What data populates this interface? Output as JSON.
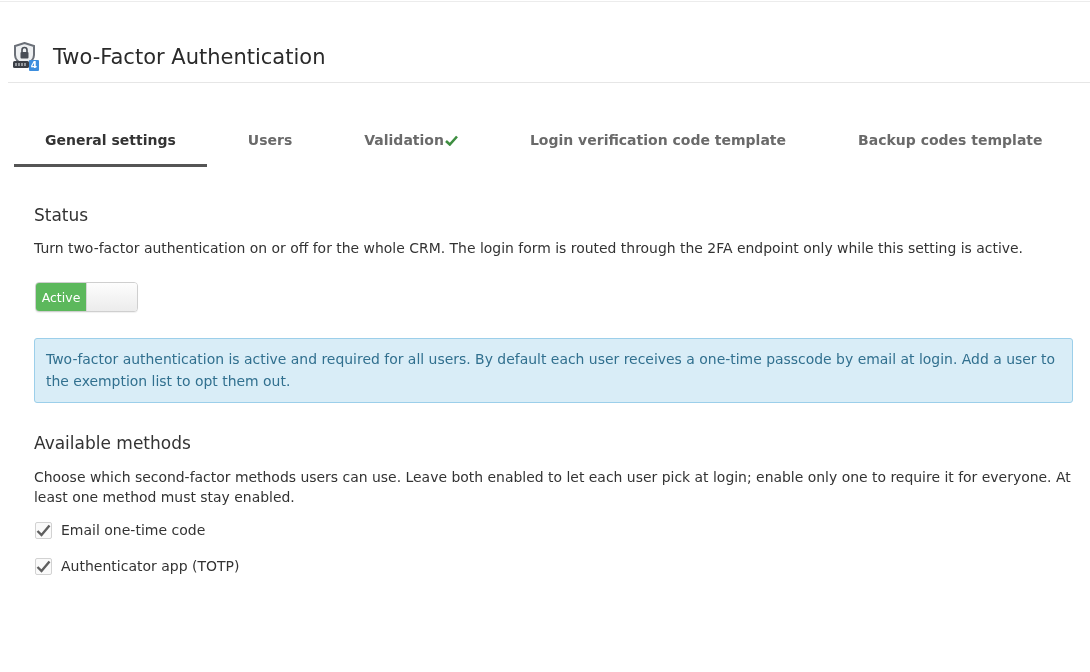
{
  "header": {
    "title": "Two-Factor Authentication",
    "icon_badge": "4"
  },
  "tabs": [
    {
      "label": "General settings",
      "selected": true,
      "validated": false
    },
    {
      "label": "Users",
      "selected": false,
      "validated": false
    },
    {
      "label": "Validation",
      "selected": false,
      "validated": true
    },
    {
      "label": "Login verification code template",
      "selected": false,
      "validated": false
    },
    {
      "label": "Backup codes template",
      "selected": false,
      "validated": false
    }
  ],
  "status": {
    "heading": "Status",
    "description": "Turn two-factor authentication on or off for the whole CRM. The login form is routed through the 2FA endpoint only while this setting is active.",
    "toggle": {
      "label": "Active",
      "on": true
    },
    "info_box": {
      "text": "Two-factor authentication is active and required for all users. By default each user receives a one-time passcode by email at login. Add a user to the exemption list to opt them out."
    }
  },
  "methods": {
    "heading": "Available methods",
    "description": "Choose which second-factor methods users can use. Leave both enabled to let each user pick at login; enable only one to require it for everyone. At least one method must stay enabled.",
    "options": [
      {
        "label": "Email one-time code",
        "checked": true
      },
      {
        "label": "Authenticator app (TOTP)",
        "checked": true
      }
    ]
  }
}
